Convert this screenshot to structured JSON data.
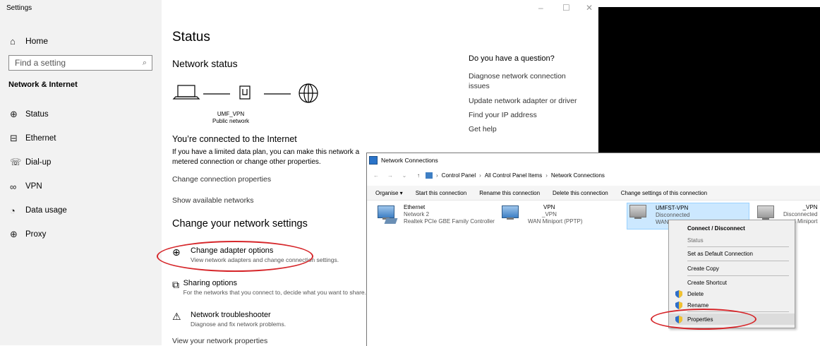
{
  "settings": {
    "app_title": "Settings",
    "home_label": "Home",
    "search_placeholder": "Find a setting",
    "section_title": "Network & Internet",
    "nav_items": [
      {
        "label": "Status",
        "icon": "status-icon"
      },
      {
        "label": "Ethernet",
        "icon": "ethernet-icon"
      },
      {
        "label": "Dial-up",
        "icon": "dialup-icon"
      },
      {
        "label": "VPN",
        "icon": "vpn-icon"
      },
      {
        "label": "Data usage",
        "icon": "data-usage-icon"
      },
      {
        "label": "Proxy",
        "icon": "proxy-icon"
      }
    ],
    "window_controls": {
      "minimize": "–",
      "maximize": "☐",
      "close": "✕"
    }
  },
  "main": {
    "page_title": "Status",
    "network_status_heading": "Network status",
    "connection_name": "UMF_VPN",
    "connection_type": "Public network",
    "connected_title": "You’re connected to the Internet",
    "plan_text": "If you have a limited data plan, you can make this network a metered connection or change other properties.",
    "change_connection_props": "Change connection properties",
    "show_available_networks": "Show available networks",
    "change_settings_heading": "Change your network settings",
    "options": [
      {
        "title": "Change adapter options",
        "desc": "View network adapters and change connection settings."
      },
      {
        "title": "Sharing options",
        "desc": "For the networks that you connect to, decide what you want to share."
      },
      {
        "title": "Network troubleshooter",
        "desc": "Diagnose and fix network problems."
      }
    ],
    "view_network_properties": "View your network properties"
  },
  "help": {
    "title": "Do you have a question?",
    "links": [
      "Diagnose network connection issues",
      "Update network adapter or driver",
      "Find your IP address",
      "Get help"
    ]
  },
  "network_connections": {
    "window_title": "Network Connections",
    "breadcrumb": [
      "Control Panel",
      "All Control Panel Items",
      "Network Connections"
    ],
    "toolbar": [
      "Organise ▾",
      "Start this connection",
      "Rename this connection",
      "Delete this connection",
      "Change settings of this connection"
    ],
    "connections": [
      {
        "name": "Ethernet",
        "line2": "Network 2",
        "line3": "Realtek PCIe GBE Family Controller"
      },
      {
        "name": "VPN",
        "line2": "_VPN",
        "line3": "WAN Miniport (PPTP)"
      },
      {
        "name": "UMFST-VPN",
        "line2": "Disconnected",
        "line3": "WAN"
      },
      {
        "name": "_VPN",
        "line2": "Disconnected",
        "line3": "l Miniport"
      }
    ]
  },
  "context_menu": {
    "items": [
      "Connect / Disconnect",
      "Status",
      "Set as Default Connection",
      "Create Copy",
      "Create Shortcut",
      "Delete",
      "Rename",
      "Properties"
    ]
  },
  "colors": {
    "annotation_red": "#d6262a",
    "selection_blue": "#cce8ff",
    "sidebar_bg": "#f2f2f2"
  }
}
